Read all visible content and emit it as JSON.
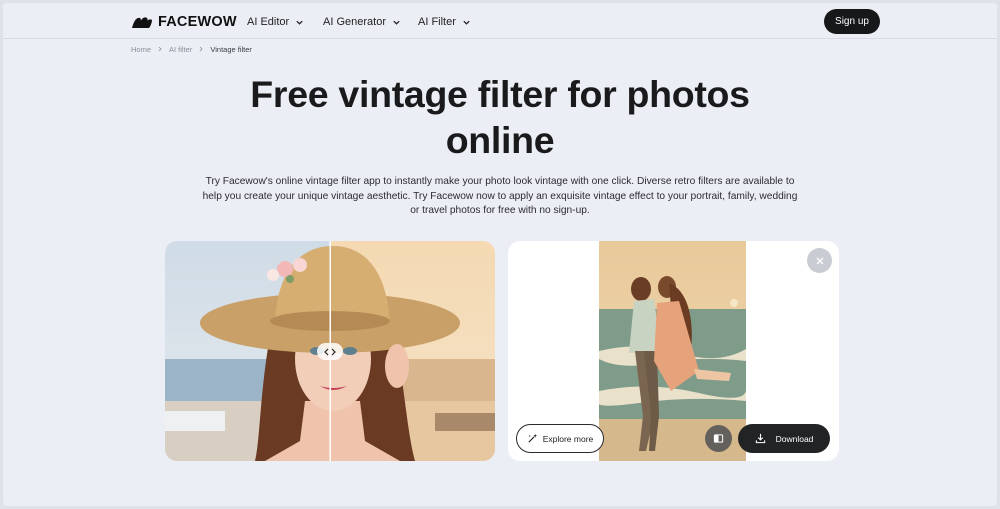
{
  "brand": {
    "name": "FACEWOW"
  },
  "nav": {
    "items": [
      {
        "label": "AI Editor"
      },
      {
        "label": "AI Generator"
      },
      {
        "label": "AI Filter"
      }
    ],
    "signup_label": "Sign up"
  },
  "breadcrumb": {
    "items": [
      "Home",
      "AI filter"
    ],
    "current": "Vintage filter"
  },
  "hero": {
    "title_line1": "Free vintage filter for photos",
    "title_line2": "online",
    "description": "Try Facewow's online vintage filter app to instantly make your photo look vintage with one click. Diverse retro filters are available to help you create your unique vintage aesthetic. Try Facewow now to apply an exquisite vintage effect to your portrait, family, wedding or travel photos for free with no sign-up."
  },
  "result": {
    "explore_label": "Explore more",
    "download_label": "Download"
  },
  "icons": {
    "logo": "facewow-logo-icon",
    "chevron": "chevron-down-icon",
    "breadcrumb_sep": "chevron-right-icon",
    "compare_handle": "compare-arrows-icon",
    "close": "close-icon",
    "explore": "magic-wand-icon",
    "compare_toggle": "split-view-icon",
    "download": "download-icon"
  },
  "colors": {
    "background": "#eceef5",
    "primary_button": "#17181a",
    "card": "#ffffff"
  }
}
